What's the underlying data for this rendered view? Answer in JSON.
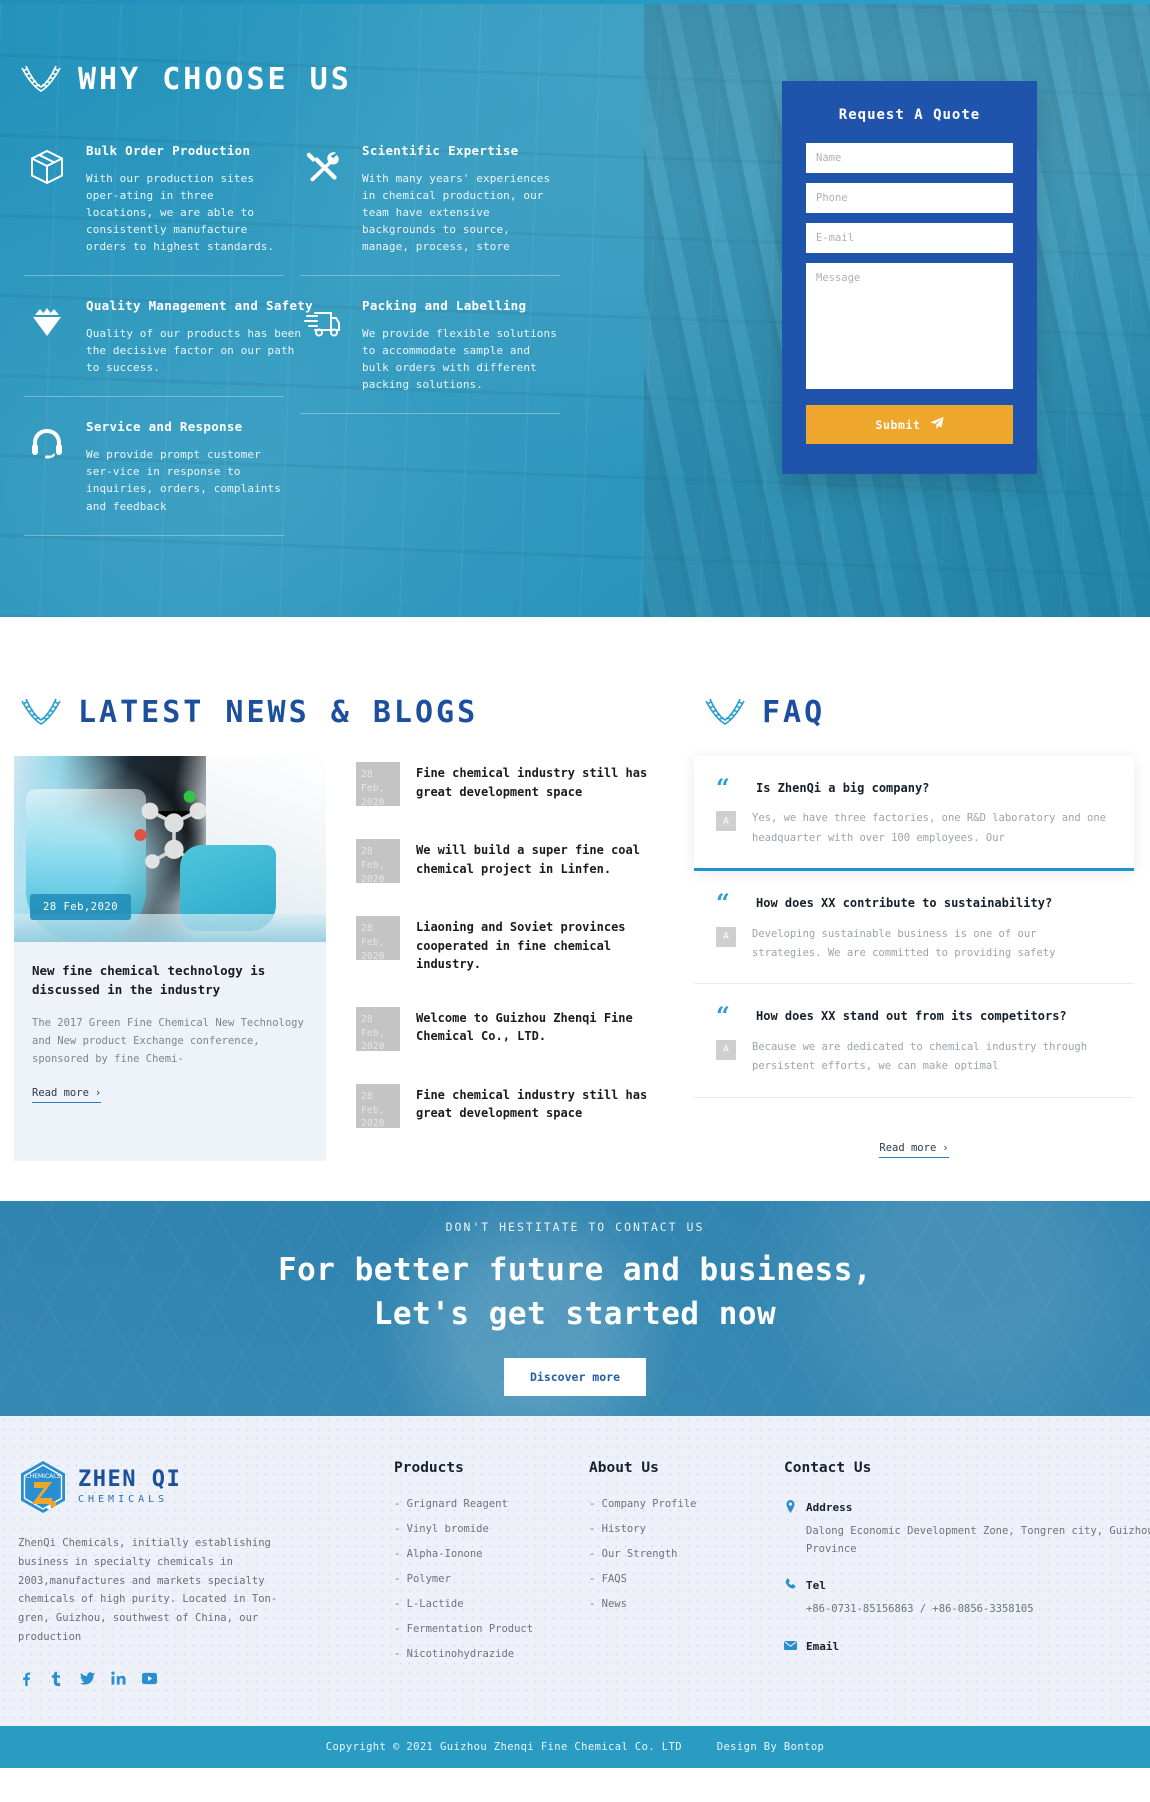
{
  "why": {
    "heading": "WHY CHOOSE US",
    "features_left": [
      {
        "icon": "box-icon",
        "title": "Bulk Order Production",
        "text": "With our production sites oper-ating in three locations, we are able to consistently manufacture orders to highest standards."
      },
      {
        "icon": "diamond-icon",
        "title": "Quality Management and Safety",
        "text": "Quality of our products has been the decisive factor on our path to success."
      },
      {
        "icon": "headset-icon",
        "title": "Service and Response",
        "text": "We provide prompt customer ser-vice in response to inquiries, orders, complaints and feedback"
      }
    ],
    "features_right": [
      {
        "icon": "tools-icon",
        "title": "Scientific Expertise",
        "text": "With many years' experiences in chemical production, our team have extensive backgrounds to source, manage, process, store"
      },
      {
        "icon": "truck-icon",
        "title": "Packing and Labelling",
        "text": "We provide flexible solutions to accommodate sample and bulk orders with different packing solutions."
      }
    ]
  },
  "quote": {
    "title": "Request A Quote",
    "name_placeholder": "Name",
    "phone_placeholder": "Phone",
    "email_placeholder": "E-mail",
    "message_placeholder": "Message",
    "submit_label": "Submit"
  },
  "news": {
    "heading": "LATEST NEWS & BLOGS",
    "featured": {
      "date_badge": "28 Feb,2020",
      "title": "New fine chemical technology is discussed in the industry",
      "excerpt": "The 2017 Green Fine Chemical New Technology and New product Exchange conference, sponsored by fine Chemi-",
      "read_more": "Read more"
    },
    "items": [
      {
        "day": "28 Feb,",
        "year": "2020",
        "title": "Fine chemical industry still has great development space"
      },
      {
        "day": "28 Feb,",
        "year": "2020",
        "title": "We will build a super fine coal chemical project in Linfen."
      },
      {
        "day": "28 Feb,",
        "year": "2020",
        "title": "Liaoning and Soviet provinces cooperated in fine chemical industry."
      },
      {
        "day": "28 Feb,",
        "year": "2020",
        "title": "Welcome to Guizhou Zhenqi Fine Chemical Co., LTD."
      },
      {
        "day": "28 Feb,",
        "year": "2020",
        "title": "Fine chemical industry still has great development space"
      }
    ]
  },
  "faq": {
    "heading": "FAQ",
    "answer_badge": "A",
    "items": [
      {
        "question": "Is ZhenQi a big company?",
        "answer": "Yes, we have three factories, one R&D laboratory and one headquarter with over 100 employees. Our"
      },
      {
        "question": "How does XX contribute to sustainability?",
        "answer": "Developing sustainable business is one of our strategies. We are committed to providing safety"
      },
      {
        "question": "How does XX stand out from its competitors?",
        "answer": "Because we are dedicated to chemical industry through persistent efforts, we can make optimal"
      }
    ],
    "read_more": "Read more"
  },
  "cta": {
    "kicker": "DON'T HESTITATE TO CONTACT US",
    "title_line1": "For better future and business,",
    "title_line2": "Let's get started now",
    "button": "Discover more"
  },
  "footer": {
    "logo_line1": "ZHEN QI",
    "logo_line2": "CHEMICALS",
    "logo_mark": "CHEMICALS",
    "description": "ZhenQi Chemicals, initially establishing business in specialty chemicals in 2003,manufactures and markets specialty chemicals of high purity. Located in Ton-gren, Guizhou, southwest of China, our production",
    "socials": [
      "facebook-icon",
      "tumblr-icon",
      "twitter-icon",
      "linkedin-icon",
      "youtube-icon"
    ],
    "products": {
      "title": "Products",
      "items": [
        "- Grignard Reagent",
        "- Vinyl bromide",
        "- Alpha-Ionone",
        "- Polymer",
        "- L-Lactide",
        "- Fermentation Product",
        "- Nicotinohydrazide"
      ]
    },
    "about": {
      "title": "About Us",
      "items": [
        "- Company Profile",
        "- History",
        "- Our Strength",
        "- FAQS",
        "- News"
      ]
    },
    "contact": {
      "title": "Contact Us",
      "address_label": "Address",
      "address_value": "Dalong Economic Development Zone, Tongren city, Guizhou Province",
      "tel_label": "Tel",
      "tel_value": "+86-0731-85156863 / +86-0856-3358105",
      "email_label": "Email"
    },
    "copyright": "Copyright © 2021 Guizhou Zhenqi Fine Chemical Co. LTD",
    "design_by": "Design By Bontop"
  }
}
